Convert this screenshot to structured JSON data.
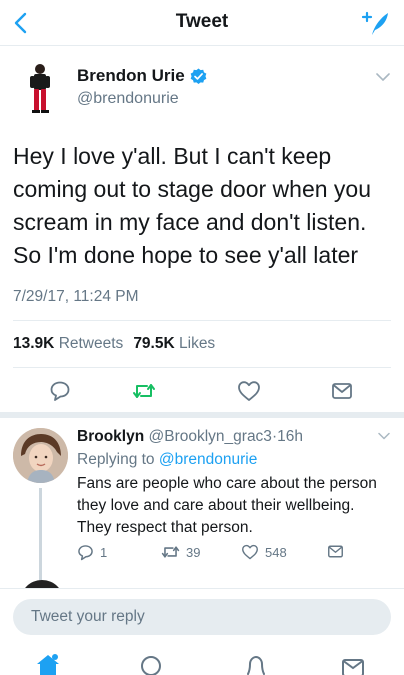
{
  "header": {
    "title": "Tweet"
  },
  "tweet": {
    "author_name": "Brendon Urie",
    "author_handle": "@brendonurie",
    "text": "Hey I love y'all. But I can't keep coming out to stage door when you scream in my face and don't listen. So I'm done hope to see y'all later",
    "timestamp": "7/29/17, 11:24 PM",
    "retweets_count": "13.9K",
    "retweets_label": "Retweets",
    "likes_count": "79.5K",
    "likes_label": "Likes"
  },
  "reply": {
    "author_name": "Brooklyn",
    "author_handle": "@Brooklyn_grac3",
    "separator": "·",
    "time": "16h",
    "replying_prefix": "Replying to",
    "replying_mention": "@brendonurie",
    "text": "Fans are people who care about the person they love and care about their wellbeing. They respect that person.",
    "reply_count": "1",
    "retweet_count": "39",
    "like_count": "548"
  },
  "composer": {
    "placeholder": "Tweet your reply"
  },
  "icons": {
    "back": "chevron-left-icon",
    "compose": "compose-quill-icon",
    "verified": "verified-badge-icon",
    "caret": "chevron-down-icon",
    "reply": "reply-bubble-icon",
    "retweet": "retweet-icon",
    "like": "heart-icon",
    "share": "share-envelope-icon",
    "home": "home-icon",
    "search": "search-icon",
    "notifications": "bell-icon",
    "messages": "envelope-icon"
  },
  "colors": {
    "accent": "#1da1f2",
    "retweet_green": "#17bf63",
    "muted_text": "#657786",
    "primary_text": "#14171a",
    "divider": "#e6ecf0"
  }
}
